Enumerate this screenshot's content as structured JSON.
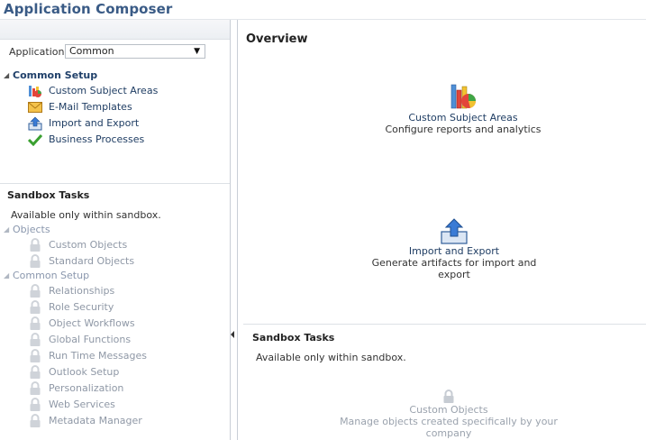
{
  "app": {
    "title": "Application Composer"
  },
  "sidebar": {
    "application_label": "Application",
    "application_value": "Common",
    "common_setup": {
      "label": "Common Setup",
      "items": [
        {
          "label": "Custom Subject Areas",
          "icon": "subject-areas-icon"
        },
        {
          "label": "E-Mail Templates",
          "icon": "envelope-icon"
        },
        {
          "label": "Import and Export",
          "icon": "import-export-icon"
        },
        {
          "label": "Business Processes",
          "icon": "checkmark-icon"
        }
      ]
    },
    "sandbox": {
      "title": "Sandbox Tasks",
      "note": "Available only within sandbox.",
      "objects": {
        "label": "Objects",
        "items": [
          {
            "label": "Custom Objects"
          },
          {
            "label": "Standard Objects"
          }
        ]
      },
      "common_setup": {
        "label": "Common Setup",
        "items": [
          {
            "label": "Relationships"
          },
          {
            "label": "Role Security"
          },
          {
            "label": "Object Workflows"
          },
          {
            "label": "Global Functions"
          },
          {
            "label": "Run Time Messages"
          },
          {
            "label": "Outlook Setup"
          },
          {
            "label": "Personalization"
          },
          {
            "label": "Web Services"
          },
          {
            "label": "Metadata Manager"
          }
        ]
      }
    }
  },
  "main": {
    "overview_title": "Overview",
    "cards": [
      {
        "title": "Custom Subject Areas",
        "subtitle": "Configure reports and analytics",
        "icon": "subject-areas-icon"
      },
      {
        "title": "Import and Export",
        "subtitle": "Generate artifacts for import and export",
        "icon": "import-export-icon"
      }
    ],
    "sandbox": {
      "title": "Sandbox Tasks",
      "note": "Available only within sandbox.",
      "card": {
        "title": "Custom Objects",
        "subtitle": "Manage objects created specifically by your company",
        "icon": "lock-icon"
      }
    }
  },
  "colors": {
    "accent": "#3a5b86",
    "link": "#1f3d63",
    "disabled": "#8f98a6",
    "border": "#c9ced6"
  }
}
